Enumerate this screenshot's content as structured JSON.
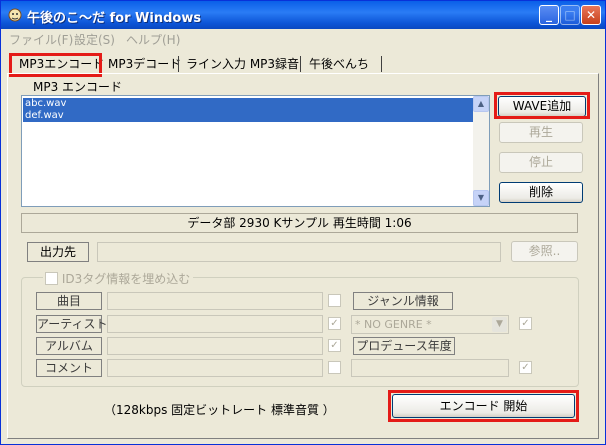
{
  "window": {
    "title": "午後のこ〜だ for Windows",
    "min": "_",
    "max": "□",
    "close": "✕"
  },
  "menu": [
    "ファイル(F)",
    "設定(S)",
    "ヘルプ(H)"
  ],
  "tabs": [
    "MP3エンコード",
    "MP3デコード",
    "ライン入力 MP3録音",
    "午後べんち"
  ],
  "panel": {
    "section_label": "MP3 エンコード",
    "files": [
      "abc.wav",
      "def.wav"
    ],
    "buttons": {
      "add_wave": "WAVE追加",
      "play": "再生",
      "stop": "停止",
      "delete": "削除",
      "browse": "参照..",
      "encode": "エンコード 開始"
    },
    "status_text": "データ部 2930 Kサンプル  再生時間 1:06",
    "output_label": "出力先",
    "id3": {
      "checkbox_label": "ID3タグ情報を埋め込む",
      "fields": {
        "title": "曲目",
        "artist": "アーティスト",
        "album": "アルバム",
        "comment": "コメント"
      },
      "genre_label": "ジャンル情報",
      "genre_value": "* NO GENRE *",
      "year_label": "プロデュース年度"
    },
    "bitrate_text": "（128kbps  固定ビットレート  標準音質 ）"
  },
  "colors": {
    "highlight": "#e41b17",
    "selection": "#316ac5",
    "titlebar": "#0a5fe8"
  }
}
